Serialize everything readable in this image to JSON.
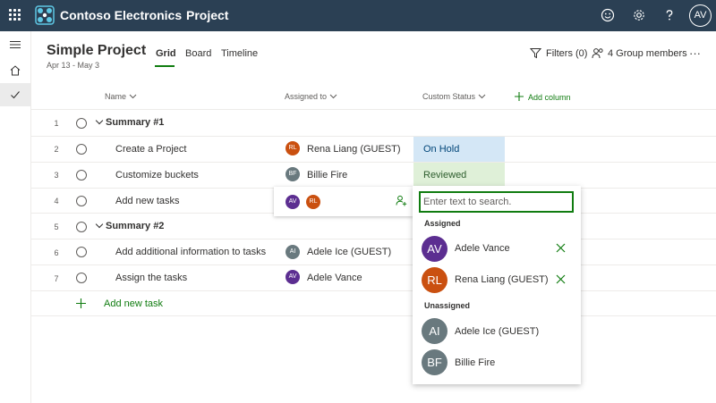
{
  "app": {
    "brand": "Contoso Electronics",
    "name": "Project",
    "user_initials": "AV"
  },
  "project": {
    "title": "Simple Project",
    "dates": "Apr 13 - May 3"
  },
  "tabs": [
    {
      "label": "Grid",
      "active": true
    },
    {
      "label": "Board",
      "active": false
    },
    {
      "label": "Timeline",
      "active": false
    }
  ],
  "toolbar": {
    "filters": "Filters (0)",
    "members": "4 Group members",
    "more": "···"
  },
  "columns": {
    "name": "Name",
    "assigned": "Assigned to",
    "status": "Custom Status",
    "add": "Add column"
  },
  "rows": [
    {
      "num": "1",
      "type": "summary",
      "name": "Summary #1"
    },
    {
      "num": "2",
      "type": "task",
      "name": "Create a Project",
      "assignee": "Rena Liang (GUEST)",
      "initials": "RL",
      "status": "On Hold"
    },
    {
      "num": "3",
      "type": "task",
      "name": "Customize buckets",
      "assignee": "Billie Fire",
      "initials": "BF",
      "status": "Reviewed"
    },
    {
      "num": "4",
      "type": "task",
      "name": "Add new tasks"
    },
    {
      "num": "5",
      "type": "summary",
      "name": "Summary #2"
    },
    {
      "num": "6",
      "type": "task",
      "name": "Add additional information to tasks",
      "assignee": "Adele Ice (GUEST)",
      "initials": "AI"
    },
    {
      "num": "7",
      "type": "task",
      "name": "Assign the tasks",
      "assignee": "Adele Vance",
      "initials": "AV"
    }
  ],
  "add_task": "Add new task",
  "assign_popup": {
    "avatars": [
      "AV",
      "RL"
    ]
  },
  "dropdown": {
    "placeholder": "Enter text to search.",
    "assigned_label": "Assigned",
    "unassigned_label": "Unassigned",
    "assigned": [
      {
        "initials": "AV",
        "name": "Adele Vance"
      },
      {
        "initials": "RL",
        "name": "Rena Liang (GUEST)"
      }
    ],
    "unassigned": [
      {
        "initials": "AI",
        "name": "Adele Ice (GUEST)"
      },
      {
        "initials": "BF",
        "name": "Billie Fire"
      }
    ]
  },
  "colors": {
    "topbar": "#2b4054",
    "accent": "#107c10",
    "on_hold": "#d4e7f6",
    "reviewed": "#dff0d8",
    "av": "#5c2e91",
    "rl": "#ca5010",
    "grey": "#69797e"
  }
}
